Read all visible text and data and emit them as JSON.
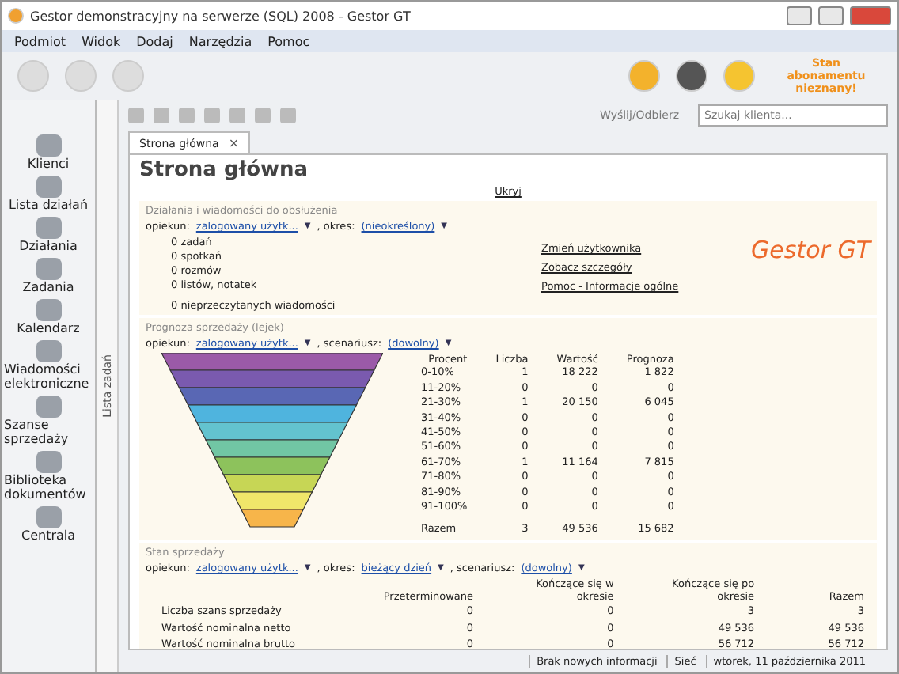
{
  "window": {
    "title": "Gestor demonstracyjny na serwerze (SQL) 2008 - Gestor GT"
  },
  "menu": [
    "Podmiot",
    "Widok",
    "Dodaj",
    "Narzędzia",
    "Pomoc"
  ],
  "subscription": "Stan abonamentu nieznany!",
  "sidebar": {
    "items": [
      {
        "label": "Klienci"
      },
      {
        "label": "Lista działań"
      },
      {
        "label": "Działania"
      },
      {
        "label": "Zadania"
      },
      {
        "label": "Kalendarz"
      },
      {
        "label": "Wiadomości elektroniczne"
      },
      {
        "label": "Szanse sprzedaży"
      },
      {
        "label": "Biblioteka dokumentów"
      },
      {
        "label": "Centrala"
      }
    ],
    "task_strip": "Lista zadań"
  },
  "toolbar": {
    "send_receive": "Wyślij/Odbierz",
    "search": {
      "placeholder": "Szukaj klienta..."
    }
  },
  "tabs": [
    {
      "label": "Strona główna",
      "selected": true,
      "close": "×"
    }
  ],
  "page": {
    "title": "Strona główna",
    "hide_link": "Ukryj",
    "actions": {
      "title": "Działania i wiadomości do obsłużenia",
      "filters": [
        {
          "label": "opiekun:",
          "value": "zalogowany użytk...",
          "caret": "▼"
        },
        {
          "label": ", okres:",
          "value": "(nieokreślony)",
          "caret": "▼"
        }
      ],
      "counts": [
        "0 zadań",
        "0 spotkań",
        "0 rozmów",
        "0 listów, notatek"
      ],
      "unread": "0 nieprzeczytanych wiadomości",
      "links": [
        "Zmień użytkownika",
        "Zobacz szczegóły",
        "Pomoc - Informacje ogólne"
      ],
      "logo": "Gestor GT"
    },
    "forecast": {
      "title": "Prognoza sprzedaży (lejek)",
      "filters": [
        {
          "label": "opiekun:",
          "value": "zalogowany użytk...",
          "caret": "▼"
        },
        {
          "label": ", scenariusz:",
          "value": "(dowolny)",
          "caret": "▼"
        }
      ],
      "columns": [
        "Procent",
        "Liczba",
        "Wartość",
        "Prognoza"
      ],
      "rows": [
        [
          "0-10%",
          "1",
          "18 222",
          "1 822"
        ],
        [
          "11-20%",
          "0",
          "0",
          "0"
        ],
        [
          "21-30%",
          "1",
          "20 150",
          "6 045"
        ],
        [
          "31-40%",
          "0",
          "0",
          "0"
        ],
        [
          "41-50%",
          "0",
          "0",
          "0"
        ],
        [
          "51-60%",
          "0",
          "0",
          "0"
        ],
        [
          "61-70%",
          "1",
          "11 164",
          "7 815"
        ],
        [
          "71-80%",
          "0",
          "0",
          "0"
        ],
        [
          "81-90%",
          "0",
          "0",
          "0"
        ],
        [
          "91-100%",
          "0",
          "0",
          "0"
        ]
      ],
      "total": [
        "Razem",
        "3",
        "49 536",
        "15 682"
      ]
    },
    "sales": {
      "title": "Stan sprzedaży",
      "filters": [
        {
          "label": "opiekun:",
          "value": "zalogowany użytk...",
          "caret": "▼"
        },
        {
          "label": ", okres:",
          "value": "bieżący dzień",
          "caret": "▼"
        },
        {
          "label": ", scenariusz:",
          "value": "(dowolny)",
          "caret": "▼"
        }
      ],
      "columns": [
        "",
        "Przeterminowane",
        "Kończące się w okresie",
        "Kończące się po okresie",
        "Razem"
      ],
      "rows": [
        [
          "Liczba szans sprzedaży",
          "0",
          "0",
          "3",
          "3"
        ],
        [
          "Wartość nominalna netto",
          "0",
          "0",
          "49 536",
          "49 536"
        ],
        [
          "Wartość nominalna brutto",
          "0",
          "0",
          "56 712",
          "56 712"
        ]
      ]
    }
  },
  "status_bar": [
    "Brak nowych informacji",
    "Sieć",
    "wtorek, 11 października 2011"
  ]
}
